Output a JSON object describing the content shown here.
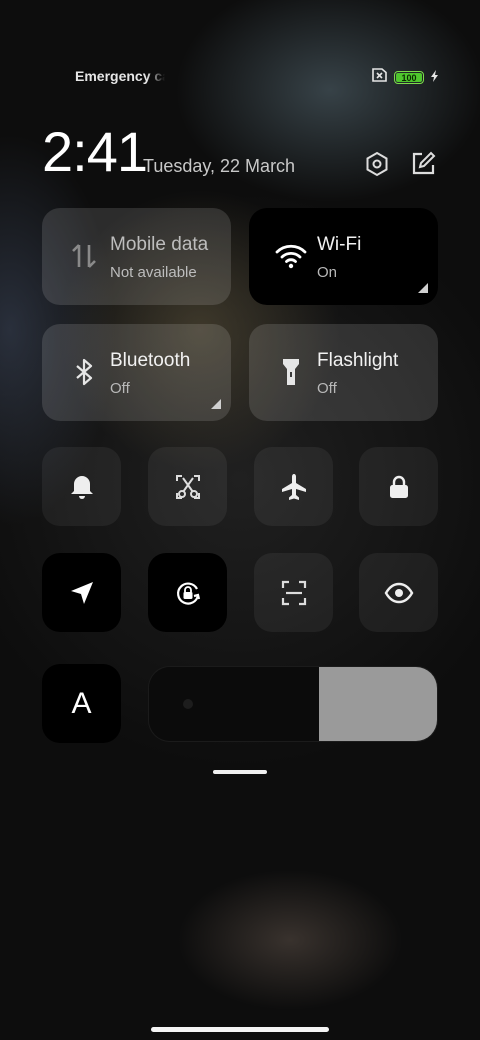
{
  "status_bar": {
    "carrier_text": "Emergency calls only",
    "battery_level": "100",
    "battery_color": "#4fc72d",
    "icons": [
      "no-sim-icon",
      "battery-icon",
      "charging-bolt-icon"
    ]
  },
  "header": {
    "time": "2:41",
    "date": "Tuesday, 22 March",
    "settings_icon": "settings-hex-icon",
    "edit_icon": "edit-icon"
  },
  "big_tiles": [
    {
      "title": "Mobile data",
      "subtitle": "Not available",
      "icon": "mobile-data-icon",
      "active": false
    },
    {
      "title": "Wi-Fi",
      "subtitle": "On",
      "icon": "wifi-icon",
      "active": true
    },
    {
      "title": "Bluetooth",
      "subtitle": "Off",
      "icon": "bluetooth-icon",
      "active": false
    },
    {
      "title": "Flashlight",
      "subtitle": "Off",
      "icon": "flashlight-icon",
      "active": false
    }
  ],
  "small_tiles": [
    {
      "icon": "bell-icon",
      "active": false
    },
    {
      "icon": "screenshot-scissors-icon",
      "active": false
    },
    {
      "icon": "airplane-icon",
      "active": false
    },
    {
      "icon": "lock-icon",
      "active": false
    },
    {
      "icon": "location-icon",
      "active": true
    },
    {
      "icon": "auto-rotate-lock-icon",
      "active": true
    },
    {
      "icon": "scanner-icon",
      "active": false
    },
    {
      "icon": "eye-icon",
      "active": false
    }
  ],
  "brightness": {
    "auto_label": "A",
    "level_fraction": 0.41,
    "icon": "brightness-sun-icon"
  }
}
